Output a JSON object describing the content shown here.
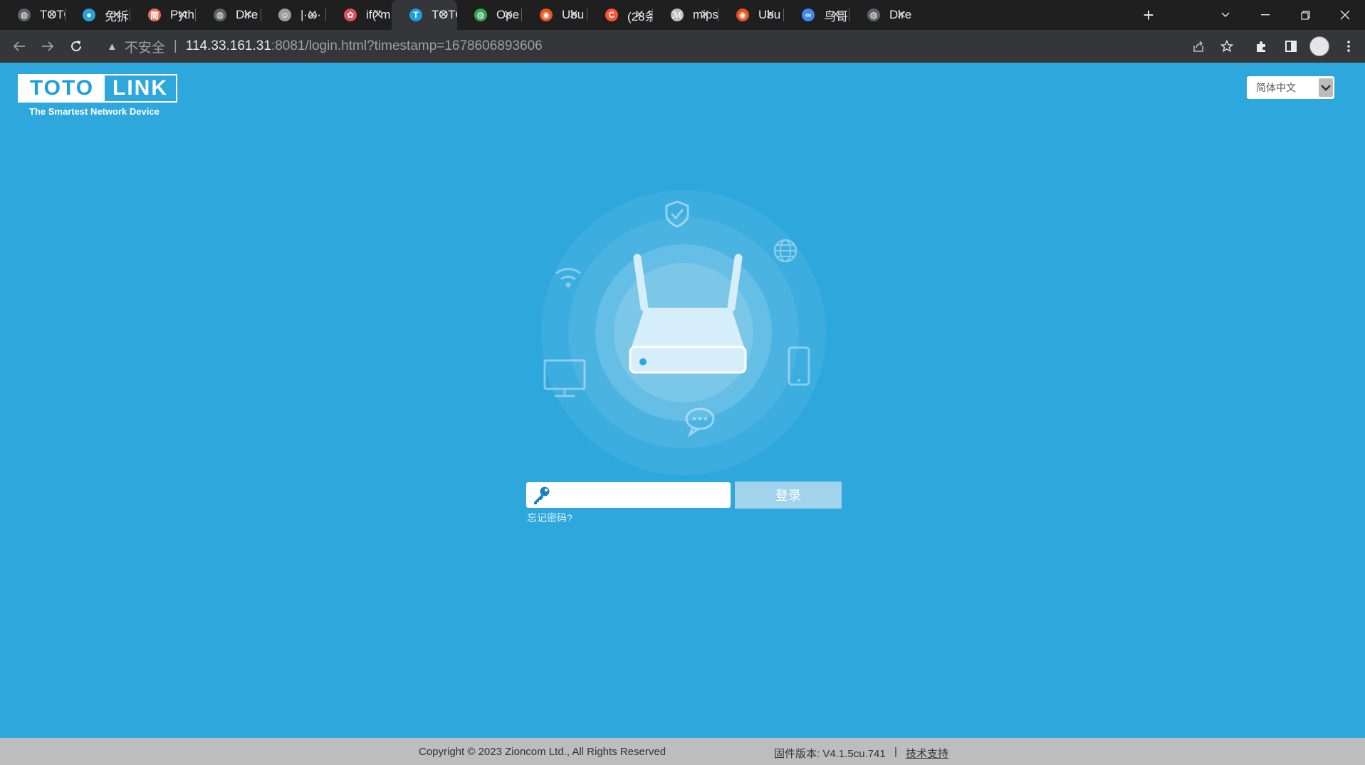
{
  "browser": {
    "tabs": [
      {
        "title": "TOTO",
        "icon": "globe-icon",
        "color": "#5f6368"
      },
      {
        "title": "免拆",
        "icon": "blue-circle-icon",
        "color": "#29a3d9"
      },
      {
        "title": "Pyth",
        "icon": "jianshu-icon",
        "color": "#ea6f5a"
      },
      {
        "title": "Dire",
        "icon": "globe-icon",
        "color": "#5f6368"
      },
      {
        "title": "|·ω·",
        "icon": "avatar-icon",
        "color": "#9e9e9e"
      },
      {
        "title": "if(\"m",
        "icon": "flower-icon",
        "color": "#e0505a"
      },
      {
        "title": "TOTO",
        "icon": "totolink-t-icon",
        "color": "#1aa0dc"
      },
      {
        "title": "Ope",
        "icon": "openwrt-icon",
        "color": "#3aa655"
      },
      {
        "title": "Ubu",
        "icon": "ubuntu-icon",
        "color": "#e95420"
      },
      {
        "title": "(28条",
        "icon": "csdn-icon",
        "color": "#fc5531"
      },
      {
        "title": "mips",
        "icon": "script-icon",
        "color": "#bdbdbd"
      },
      {
        "title": "Ubu",
        "icon": "ubuntu-icon",
        "color": "#e95420"
      },
      {
        "title": "鸟哥",
        "icon": "infinity-icon",
        "color": "#4285f4"
      },
      {
        "title": "Dire",
        "icon": "globe-icon",
        "color": "#5f6368"
      }
    ],
    "active_tab": 6,
    "close_glyph": "✕",
    "newtab_glyph": "+",
    "url": {
      "insecure_label": "不安全",
      "separator": "|",
      "host": "114.33.161.31",
      "rest": ":8081/login.html?timestamp=1678606893606"
    }
  },
  "page": {
    "logo": {
      "brand_left": "TOTO",
      "brand_right": "LINK",
      "tagline": "The Smartest Network Device"
    },
    "language": {
      "selected": "简体中文"
    },
    "login": {
      "password_placeholder": "",
      "button_label": "登录",
      "forgot_label": "忘记密码?"
    },
    "footer": {
      "copyright": "Copyright © 2023 Zioncom Ltd., All Rights Reserved",
      "firmware": "固件版本: V4.1.5cu.741",
      "separator": "|",
      "support_link": "技术支持"
    }
  },
  "colors": {
    "page_bg": "#2ea7dd",
    "footer_bg": "#bdbdbd",
    "login_button": "#a1d3ec"
  }
}
